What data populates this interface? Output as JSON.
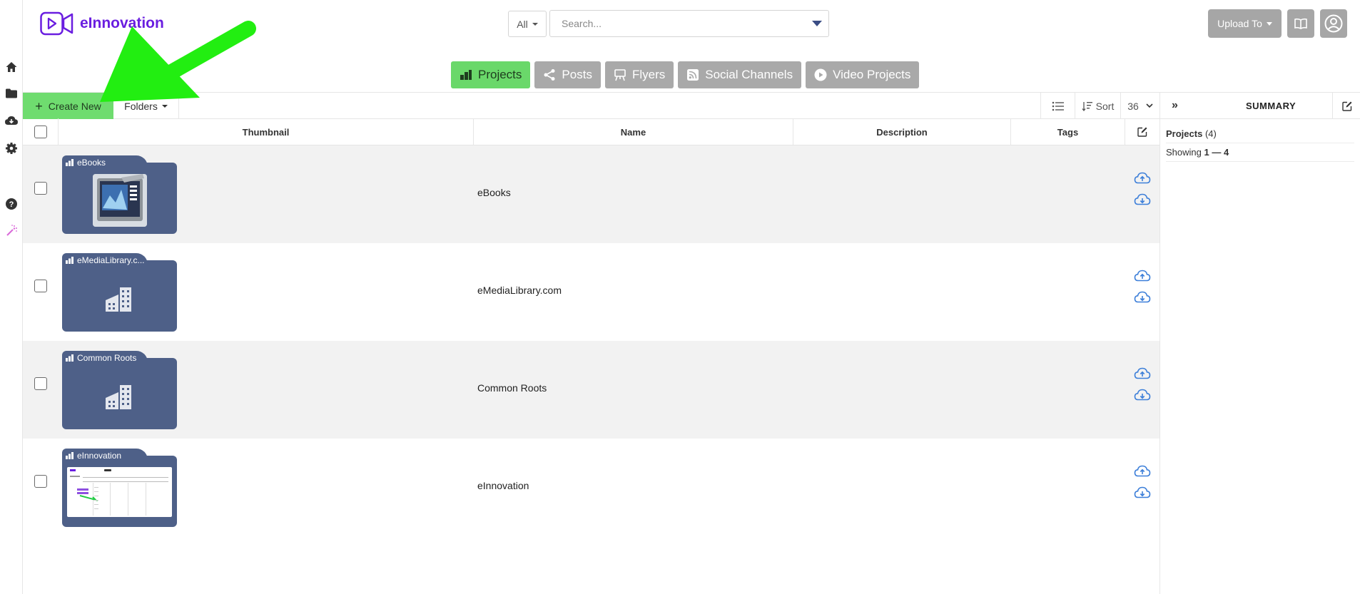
{
  "header": {
    "logo_text": "eInnovation",
    "filter_value": "All",
    "search_placeholder": "Search...",
    "upload_label": "Upload To"
  },
  "tabs": [
    {
      "label": "Projects",
      "active": true
    },
    {
      "label": "Posts"
    },
    {
      "label": "Flyers"
    },
    {
      "label": "Social Channels"
    },
    {
      "label": "Video Projects"
    }
  ],
  "toolbar": {
    "create_label": "Create New",
    "folders_label": "Folders",
    "sort_label": "Sort",
    "page_size": "36"
  },
  "table": {
    "columns": {
      "thumbnail": "Thumbnail",
      "name": "Name",
      "description": "Description",
      "tags": "Tags"
    },
    "rows": [
      {
        "folder_label": "eBooks",
        "name": "eBooks",
        "thumb": "ebook-image"
      },
      {
        "folder_label": "eMediaLibrary.c...",
        "name": "eMediaLibrary.com",
        "thumb": "building-icon"
      },
      {
        "folder_label": "Common Roots",
        "name": "Common Roots",
        "thumb": "building-icon"
      },
      {
        "folder_label": "eInnovation",
        "name": "eInnovation",
        "thumb": "screenshot-image"
      }
    ]
  },
  "summary": {
    "title": "SUMMARY",
    "projects_label": "Projects",
    "projects_count": "(4)",
    "showing_label": "Showing",
    "showing_range": "1 — 4"
  },
  "colors": {
    "accent_green": "#6fdc6f",
    "brand_purple": "#6a1ee0",
    "folder_blue": "#4e6088",
    "cloud_blue": "#3d7fd9",
    "annotation_arrow": "#22ee11"
  }
}
